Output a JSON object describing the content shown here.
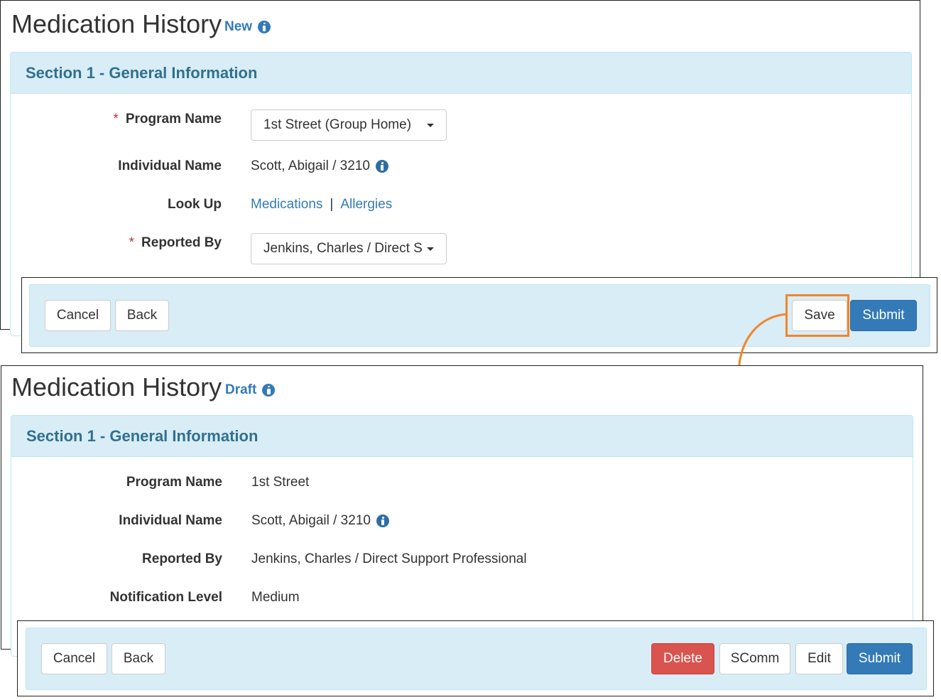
{
  "top": {
    "title": "Medication History",
    "status": "New",
    "section_title": "Section 1 - General Information",
    "fields": {
      "program_label": "Program Name",
      "program_value": "1st Street (Group Home)",
      "individual_label": "Individual Name",
      "individual_value": "Scott, Abigail / 3210",
      "lookup_label": "Look Up",
      "lookup_link_1": "Medications",
      "lookup_separator": "|",
      "lookup_link_2": "Allergies",
      "reported_label": "Reported By",
      "reported_value": "Jenkins, Charles / Direct Support Professional"
    },
    "required_marker": "*",
    "footer": {
      "cancel": "Cancel",
      "back": "Back",
      "save": "Save",
      "submit": "Submit"
    }
  },
  "bottom": {
    "title": "Medication History",
    "status": "Draft",
    "section_title": "Section 1 - General Information",
    "fields": {
      "program_label": "Program Name",
      "program_value": "1st Street",
      "individual_label": "Individual Name",
      "individual_value": "Scott, Abigail / 3210",
      "reported_label": "Reported By",
      "reported_value": "Jenkins, Charles / Direct Support Professional",
      "notification_label": "Notification Level",
      "notification_value": "Medium"
    },
    "footer": {
      "cancel": "Cancel",
      "back": "Back",
      "delete": "Delete",
      "scomm": "SComm",
      "edit": "Edit",
      "submit": "Submit"
    }
  },
  "colors": {
    "accent": "#337ab7",
    "panel_heading_bg": "#d9edf7",
    "panel_heading_text": "#31708f",
    "danger": "#d9534f",
    "highlight": "#f0862a"
  },
  "icons": [
    "info-icon",
    "caret-down-icon",
    "arrow-down-icon"
  ]
}
